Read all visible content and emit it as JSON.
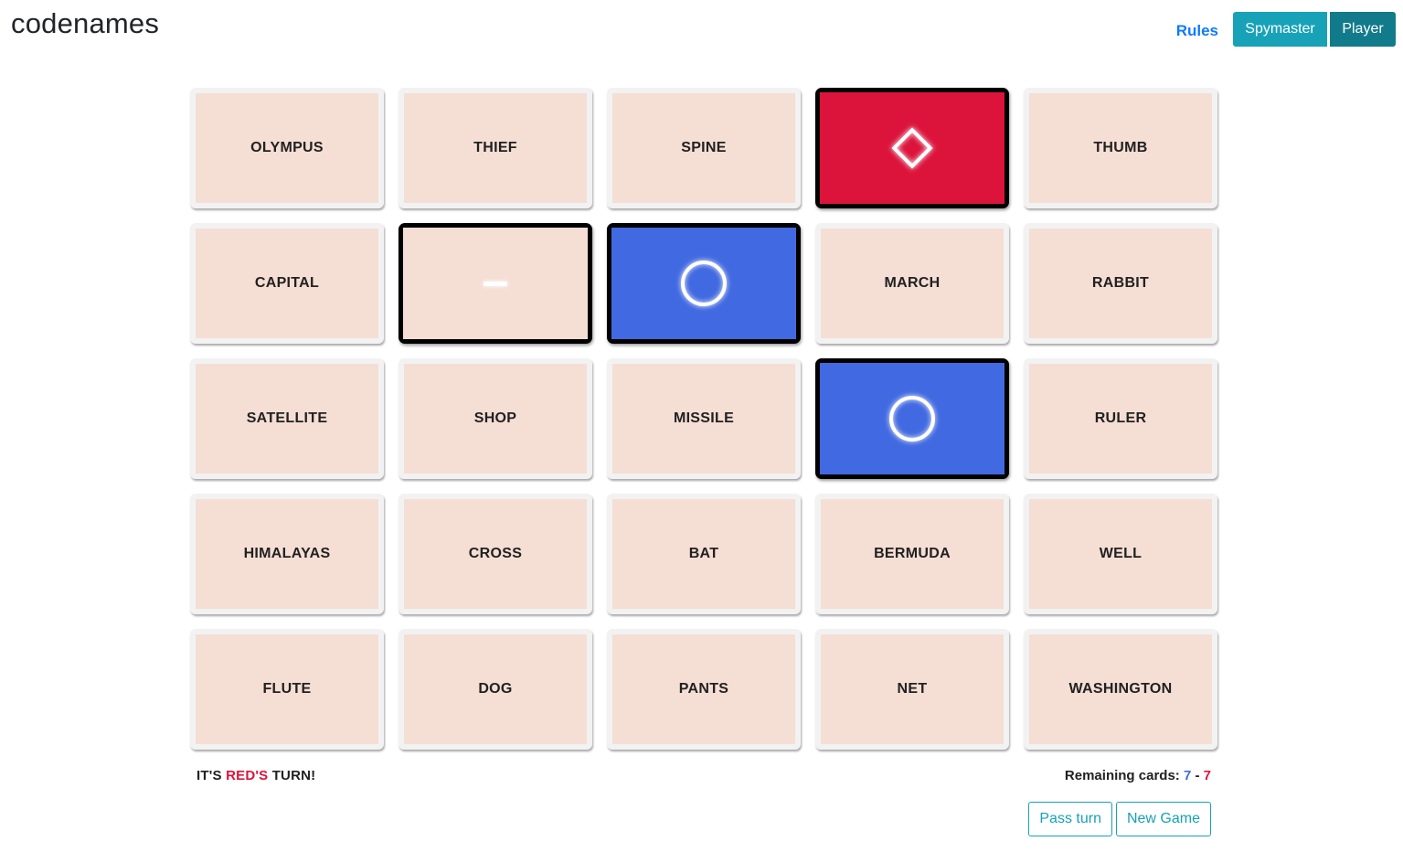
{
  "header": {
    "title": "codenames",
    "rules_label": "Rules",
    "spymaster_label": "Spymaster",
    "player_label": "Player"
  },
  "colors": {
    "red": "#dc143c",
    "blue": "#4169e1",
    "neutral": "#f5ded4",
    "accent": "#17a2b8",
    "accent_dark": "#117a8b",
    "link": "#0d7bff"
  },
  "board": {
    "cards": [
      {
        "word": "OLYMPUS",
        "revealed": false
      },
      {
        "word": "THIEF",
        "revealed": false
      },
      {
        "word": "SPINE",
        "revealed": false
      },
      {
        "word": "",
        "revealed": true,
        "team": "red",
        "icon": "diamond-icon"
      },
      {
        "word": "THUMB",
        "revealed": false
      },
      {
        "word": "CAPITAL",
        "revealed": false
      },
      {
        "word": "",
        "revealed": true,
        "team": "neutral",
        "icon": "dash-icon"
      },
      {
        "word": "",
        "revealed": true,
        "team": "blue",
        "icon": "circle-icon"
      },
      {
        "word": "MARCH",
        "revealed": false
      },
      {
        "word": "RABBIT",
        "revealed": false
      },
      {
        "word": "SATELLITE",
        "revealed": false
      },
      {
        "word": "SHOP",
        "revealed": false
      },
      {
        "word": "MISSILE",
        "revealed": false
      },
      {
        "word": "",
        "revealed": true,
        "team": "blue",
        "icon": "circle-icon"
      },
      {
        "word": "RULER",
        "revealed": false
      },
      {
        "word": "HIMALAYAS",
        "revealed": false
      },
      {
        "word": "CROSS",
        "revealed": false
      },
      {
        "word": "BAT",
        "revealed": false
      },
      {
        "word": "BERMUDA",
        "revealed": false
      },
      {
        "word": "WELL",
        "revealed": false
      },
      {
        "word": "FLUTE",
        "revealed": false
      },
      {
        "word": "DOG",
        "revealed": false
      },
      {
        "word": "PANTS",
        "revealed": false
      },
      {
        "word": "NET",
        "revealed": false
      },
      {
        "word": "WASHINGTON",
        "revealed": false
      }
    ]
  },
  "status": {
    "prefix": "IT'S ",
    "team": "RED'S",
    "suffix": " TURN!"
  },
  "remaining": {
    "label": "Remaining cards: ",
    "blue": "7",
    "separator": " - ",
    "red": "7"
  },
  "actions": {
    "pass_label": "Pass turn",
    "new_game_label": "New Game"
  }
}
